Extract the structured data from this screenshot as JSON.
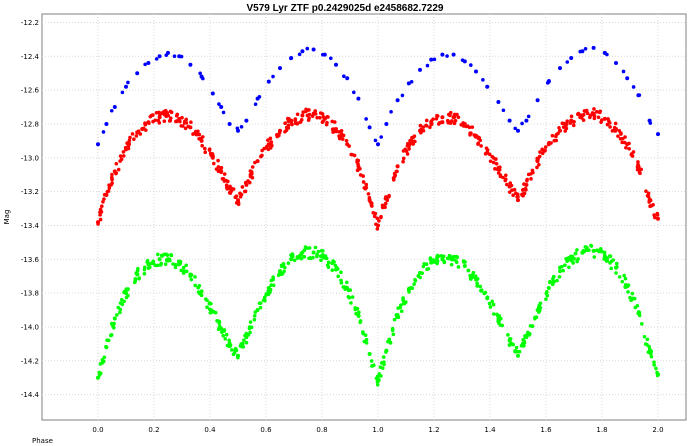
{
  "chart_data": {
    "type": "scatter",
    "title": "V579 Lyr ZTF p0.2429025d e2458682.7229",
    "xlabel": "Phase",
    "ylabel": "Mag",
    "xlim": [
      -0.2,
      2.1
    ],
    "ylim": [
      -14.55,
      -12.15
    ],
    "y_inverted_display": true,
    "grid": true,
    "x_ticks": [
      0.0,
      0.2,
      0.4,
      0.6,
      0.8,
      1.0,
      1.2,
      1.4,
      1.6,
      1.8,
      2.0
    ],
    "x_tick_labels": [
      "0.0",
      "0.2",
      "0.4",
      "0.6",
      "0.8",
      "1.0",
      "1.2",
      "1.4",
      "1.6",
      "1.8",
      "2.0"
    ],
    "y_ticks": [
      -12.2,
      -12.4,
      -12.6,
      -12.8,
      -13.0,
      -13.2,
      -13.4,
      -13.6,
      -13.8,
      -14.0,
      -14.2,
      -14.4
    ],
    "y_tick_labels": [
      "-12.2",
      "-12.4",
      "-12.6",
      "-12.8",
      "-13.0",
      "-13.2",
      "-13.4",
      "-13.6",
      "-13.8",
      "-14.0",
      "-14.2",
      "-14.4"
    ],
    "series": [
      {
        "color": "#0000ff",
        "values": [
          {
            "phase": 0.0,
            "mag": -12.92
          },
          {
            "phase": 0.03,
            "mag": -12.8
          },
          {
            "phase": 0.06,
            "mag": -12.7
          },
          {
            "phase": 0.1,
            "mag": -12.58
          },
          {
            "phase": 0.14,
            "mag": -12.5
          },
          {
            "phase": 0.18,
            "mag": -12.44
          },
          {
            "phase": 0.22,
            "mag": -12.4
          },
          {
            "phase": 0.25,
            "mag": -12.38
          },
          {
            "phase": 0.29,
            "mag": -12.4
          },
          {
            "phase": 0.33,
            "mag": -12.45
          },
          {
            "phase": 0.37,
            "mag": -12.52
          },
          {
            "phase": 0.41,
            "mag": -12.62
          },
          {
            "phase": 0.44,
            "mag": -12.7
          },
          {
            "phase": 0.47,
            "mag": -12.8
          },
          {
            "phase": 0.5,
            "mag": -12.84
          },
          {
            "phase": 0.53,
            "mag": -12.78
          },
          {
            "phase": 0.57,
            "mag": -12.65
          },
          {
            "phase": 0.61,
            "mag": -12.55
          },
          {
            "phase": 0.65,
            "mag": -12.47
          },
          {
            "phase": 0.69,
            "mag": -12.41
          },
          {
            "phase": 0.73,
            "mag": -12.37
          },
          {
            "phase": 0.77,
            "mag": -12.36
          },
          {
            "phase": 0.81,
            "mag": -12.39
          },
          {
            "phase": 0.85,
            "mag": -12.45
          },
          {
            "phase": 0.89,
            "mag": -12.53
          },
          {
            "phase": 0.93,
            "mag": -12.65
          },
          {
            "phase": 0.97,
            "mag": -12.82
          },
          {
            "phase": 1.0,
            "mag": -12.92
          },
          {
            "phase": 1.03,
            "mag": -12.8
          },
          {
            "phase": 1.07,
            "mag": -12.66
          },
          {
            "phase": 1.11,
            "mag": -12.56
          },
          {
            "phase": 1.15,
            "mag": -12.48
          },
          {
            "phase": 1.19,
            "mag": -12.42
          },
          {
            "phase": 1.23,
            "mag": -12.39
          },
          {
            "phase": 1.27,
            "mag": -12.39
          },
          {
            "phase": 1.31,
            "mag": -12.43
          },
          {
            "phase": 1.35,
            "mag": -12.49
          },
          {
            "phase": 1.39,
            "mag": -12.58
          },
          {
            "phase": 1.43,
            "mag": -12.67
          },
          {
            "phase": 1.47,
            "mag": -12.78
          },
          {
            "phase": 1.5,
            "mag": -12.84
          },
          {
            "phase": 1.53,
            "mag": -12.78
          },
          {
            "phase": 1.57,
            "mag": -12.66
          },
          {
            "phase": 1.61,
            "mag": -12.55
          },
          {
            "phase": 1.65,
            "mag": -12.47
          },
          {
            "phase": 1.69,
            "mag": -12.41
          },
          {
            "phase": 1.73,
            "mag": -12.37
          },
          {
            "phase": 1.77,
            "mag": -12.35
          },
          {
            "phase": 1.81,
            "mag": -12.38
          },
          {
            "phase": 1.85,
            "mag": -12.44
          },
          {
            "phase": 1.89,
            "mag": -12.53
          },
          {
            "phase": 1.93,
            "mag": -12.63
          },
          {
            "phase": 1.97,
            "mag": -12.78
          },
          {
            "phase": 2.0,
            "mag": -12.86
          }
        ]
      },
      {
        "color": "#ff0000",
        "values": [
          {
            "phase": 0.0,
            "mag": -13.38
          },
          {
            "phase": 0.03,
            "mag": -13.22
          },
          {
            "phase": 0.06,
            "mag": -13.08
          },
          {
            "phase": 0.1,
            "mag": -12.95
          },
          {
            "phase": 0.14,
            "mag": -12.85
          },
          {
            "phase": 0.18,
            "mag": -12.79
          },
          {
            "phase": 0.22,
            "mag": -12.76
          },
          {
            "phase": 0.25,
            "mag": -12.75
          },
          {
            "phase": 0.29,
            "mag": -12.77
          },
          {
            "phase": 0.33,
            "mag": -12.82
          },
          {
            "phase": 0.37,
            "mag": -12.9
          },
          {
            "phase": 0.41,
            "mag": -13.0
          },
          {
            "phase": 0.44,
            "mag": -13.08
          },
          {
            "phase": 0.47,
            "mag": -13.18
          },
          {
            "phase": 0.5,
            "mag": -13.25
          },
          {
            "phase": 0.53,
            "mag": -13.16
          },
          {
            "phase": 0.57,
            "mag": -13.02
          },
          {
            "phase": 0.61,
            "mag": -12.92
          },
          {
            "phase": 0.65,
            "mag": -12.84
          },
          {
            "phase": 0.69,
            "mag": -12.78
          },
          {
            "phase": 0.73,
            "mag": -12.75
          },
          {
            "phase": 0.77,
            "mag": -12.74
          },
          {
            "phase": 0.81,
            "mag": -12.77
          },
          {
            "phase": 0.85,
            "mag": -12.83
          },
          {
            "phase": 0.89,
            "mag": -12.92
          },
          {
            "phase": 0.93,
            "mag": -13.05
          },
          {
            "phase": 0.97,
            "mag": -13.25
          },
          {
            "phase": 1.0,
            "mag": -13.4
          },
          {
            "phase": 1.03,
            "mag": -13.24
          },
          {
            "phase": 1.07,
            "mag": -13.05
          },
          {
            "phase": 1.11,
            "mag": -12.93
          },
          {
            "phase": 1.15,
            "mag": -12.84
          },
          {
            "phase": 1.19,
            "mag": -12.79
          },
          {
            "phase": 1.23,
            "mag": -12.76
          },
          {
            "phase": 1.27,
            "mag": -12.76
          },
          {
            "phase": 1.31,
            "mag": -12.8
          },
          {
            "phase": 1.35,
            "mag": -12.87
          },
          {
            "phase": 1.39,
            "mag": -12.97
          },
          {
            "phase": 1.43,
            "mag": -13.06
          },
          {
            "phase": 1.47,
            "mag": -13.17
          },
          {
            "phase": 1.5,
            "mag": -13.25
          },
          {
            "phase": 1.53,
            "mag": -13.16
          },
          {
            "phase": 1.57,
            "mag": -13.02
          },
          {
            "phase": 1.61,
            "mag": -12.92
          },
          {
            "phase": 1.65,
            "mag": -12.84
          },
          {
            "phase": 1.69,
            "mag": -12.78
          },
          {
            "phase": 1.73,
            "mag": -12.75
          },
          {
            "phase": 1.77,
            "mag": -12.74
          },
          {
            "phase": 1.81,
            "mag": -12.77
          },
          {
            "phase": 1.85,
            "mag": -12.83
          },
          {
            "phase": 1.89,
            "mag": -12.92
          },
          {
            "phase": 1.93,
            "mag": -13.05
          },
          {
            "phase": 1.97,
            "mag": -13.25
          },
          {
            "phase": 2.0,
            "mag": -13.36
          }
        ]
      },
      {
        "color": "#00ff00",
        "values": [
          {
            "phase": 0.0,
            "mag": -14.3
          },
          {
            "phase": 0.03,
            "mag": -14.12
          },
          {
            "phase": 0.06,
            "mag": -13.95
          },
          {
            "phase": 0.1,
            "mag": -13.8
          },
          {
            "phase": 0.14,
            "mag": -13.69
          },
          {
            "phase": 0.18,
            "mag": -13.63
          },
          {
            "phase": 0.22,
            "mag": -13.6
          },
          {
            "phase": 0.25,
            "mag": -13.6
          },
          {
            "phase": 0.29,
            "mag": -13.63
          },
          {
            "phase": 0.33,
            "mag": -13.69
          },
          {
            "phase": 0.37,
            "mag": -13.79
          },
          {
            "phase": 0.41,
            "mag": -13.91
          },
          {
            "phase": 0.44,
            "mag": -14.01
          },
          {
            "phase": 0.47,
            "mag": -14.1
          },
          {
            "phase": 0.5,
            "mag": -14.17
          },
          {
            "phase": 0.53,
            "mag": -14.06
          },
          {
            "phase": 0.57,
            "mag": -13.9
          },
          {
            "phase": 0.61,
            "mag": -13.77
          },
          {
            "phase": 0.65,
            "mag": -13.67
          },
          {
            "phase": 0.69,
            "mag": -13.6
          },
          {
            "phase": 0.73,
            "mag": -13.56
          },
          {
            "phase": 0.77,
            "mag": -13.56
          },
          {
            "phase": 0.81,
            "mag": -13.59
          },
          {
            "phase": 0.85,
            "mag": -13.66
          },
          {
            "phase": 0.89,
            "mag": -13.77
          },
          {
            "phase": 0.93,
            "mag": -13.93
          },
          {
            "phase": 0.97,
            "mag": -14.16
          },
          {
            "phase": 1.0,
            "mag": -14.32
          },
          {
            "phase": 1.03,
            "mag": -14.14
          },
          {
            "phase": 1.07,
            "mag": -13.93
          },
          {
            "phase": 1.11,
            "mag": -13.78
          },
          {
            "phase": 1.15,
            "mag": -13.68
          },
          {
            "phase": 1.19,
            "mag": -13.62
          },
          {
            "phase": 1.23,
            "mag": -13.6
          },
          {
            "phase": 1.27,
            "mag": -13.6
          },
          {
            "phase": 1.31,
            "mag": -13.64
          },
          {
            "phase": 1.35,
            "mag": -13.72
          },
          {
            "phase": 1.39,
            "mag": -13.83
          },
          {
            "phase": 1.43,
            "mag": -13.95
          },
          {
            "phase": 1.47,
            "mag": -14.08
          },
          {
            "phase": 1.5,
            "mag": -14.17
          },
          {
            "phase": 1.53,
            "mag": -14.06
          },
          {
            "phase": 1.57,
            "mag": -13.9
          },
          {
            "phase": 1.61,
            "mag": -13.77
          },
          {
            "phase": 1.65,
            "mag": -13.67
          },
          {
            "phase": 1.69,
            "mag": -13.6
          },
          {
            "phase": 1.73,
            "mag": -13.56
          },
          {
            "phase": 1.77,
            "mag": -13.55
          },
          {
            "phase": 1.81,
            "mag": -13.58
          },
          {
            "phase": 1.85,
            "mag": -13.65
          },
          {
            "phase": 1.89,
            "mag": -13.76
          },
          {
            "phase": 1.93,
            "mag": -13.92
          },
          {
            "phase": 1.97,
            "mag": -14.15
          },
          {
            "phase": 2.0,
            "mag": -14.28
          }
        ]
      }
    ]
  }
}
